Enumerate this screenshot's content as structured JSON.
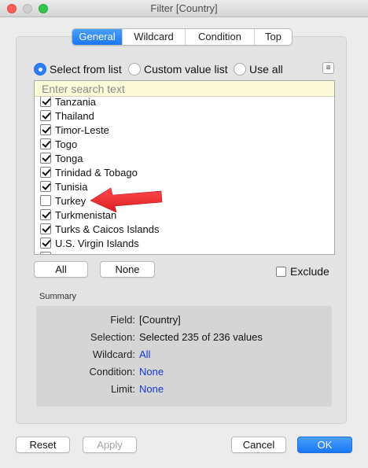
{
  "window": {
    "title": "Filter [Country]"
  },
  "tabs": [
    {
      "label": "General",
      "active": true
    },
    {
      "label": "Wildcard",
      "active": false
    },
    {
      "label": "Condition",
      "active": false
    },
    {
      "label": "Top",
      "active": false
    }
  ],
  "mode": {
    "select_from_list": "Select from list",
    "custom_value_list": "Custom value list",
    "use_all": "Use all",
    "selected": "select_from_list"
  },
  "menu_icon": "≡",
  "search": {
    "placeholder": "Enter search text"
  },
  "countries": [
    {
      "label": "Tanzania",
      "checked": true
    },
    {
      "label": "Thailand",
      "checked": true
    },
    {
      "label": "Timor-Leste",
      "checked": true
    },
    {
      "label": "Togo",
      "checked": true
    },
    {
      "label": "Tonga",
      "checked": true
    },
    {
      "label": "Trinidad & Tobago",
      "checked": true
    },
    {
      "label": "Tunisia",
      "checked": true
    },
    {
      "label": "Turkey",
      "checked": false
    },
    {
      "label": "Turkmenistan",
      "checked": true
    },
    {
      "label": "Turks & Caicos Islands",
      "checked": true
    },
    {
      "label": "U.S. Virgin Islands",
      "checked": true
    }
  ],
  "list_buttons": {
    "all": "All",
    "none": "None"
  },
  "exclude": {
    "label": "Exclude",
    "checked": false
  },
  "summary": {
    "title": "Summary",
    "field_key": "Field:",
    "field_val": "[Country]",
    "selection_key": "Selection:",
    "selection_val": "Selected 235 of 236 values",
    "wildcard_key": "Wildcard:",
    "wildcard_val": "All",
    "condition_key": "Condition:",
    "condition_val": "None",
    "limit_key": "Limit:",
    "limit_val": "None"
  },
  "footer": {
    "reset": "Reset",
    "apply": "Apply",
    "cancel": "Cancel",
    "ok": "OK"
  },
  "colors": {
    "accent": "#1a77f2",
    "annotation_arrow": "#e8282b",
    "link": "#1a33d6"
  }
}
